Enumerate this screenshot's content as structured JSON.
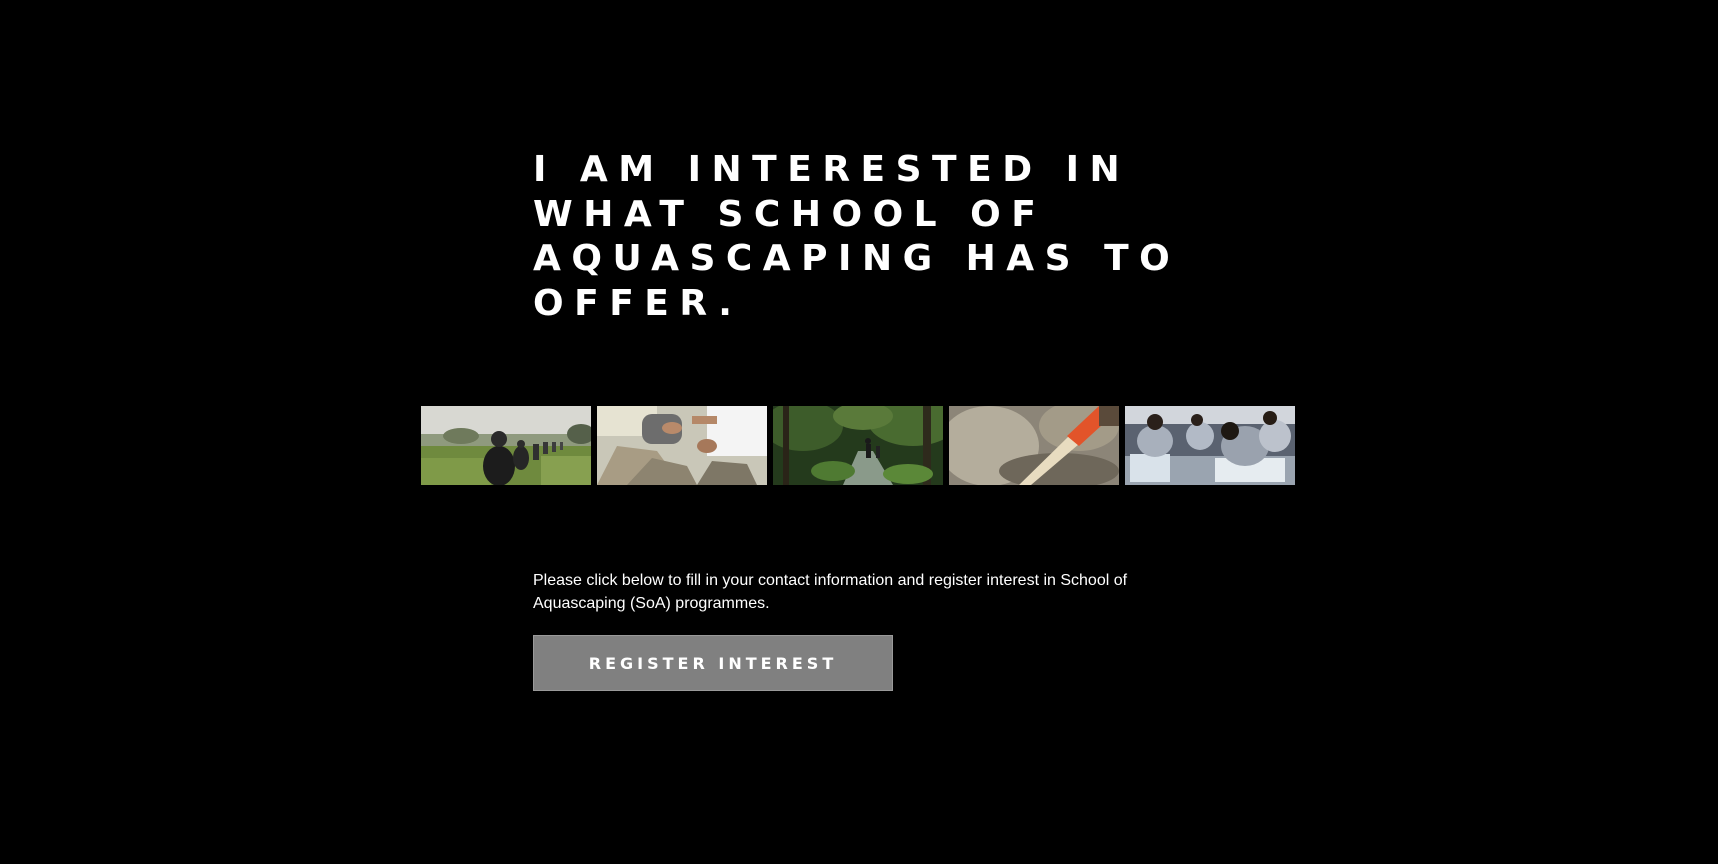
{
  "hero": {
    "heading": "I AM INTERESTED IN WHAT SCHOOL OF AQUASCAPING HAS TO OFFER."
  },
  "gallery": {
    "photos": [
      {
        "icon": "group-walking-field-photo"
      },
      {
        "icon": "hands-arranging-rocks-photo"
      },
      {
        "icon": "forest-stream-trek-photo"
      },
      {
        "icon": "brush-on-rock-photo"
      },
      {
        "icon": "students-at-tanks-photo"
      }
    ]
  },
  "intro": {
    "text": "Please click below to fill in your contact information and register interest in School of Aquascaping (SoA) programmes."
  },
  "cta": {
    "label": "REGISTER INTEREST",
    "background": "#808080"
  },
  "colors": {
    "background": "#000000",
    "text": "#ffffff"
  }
}
